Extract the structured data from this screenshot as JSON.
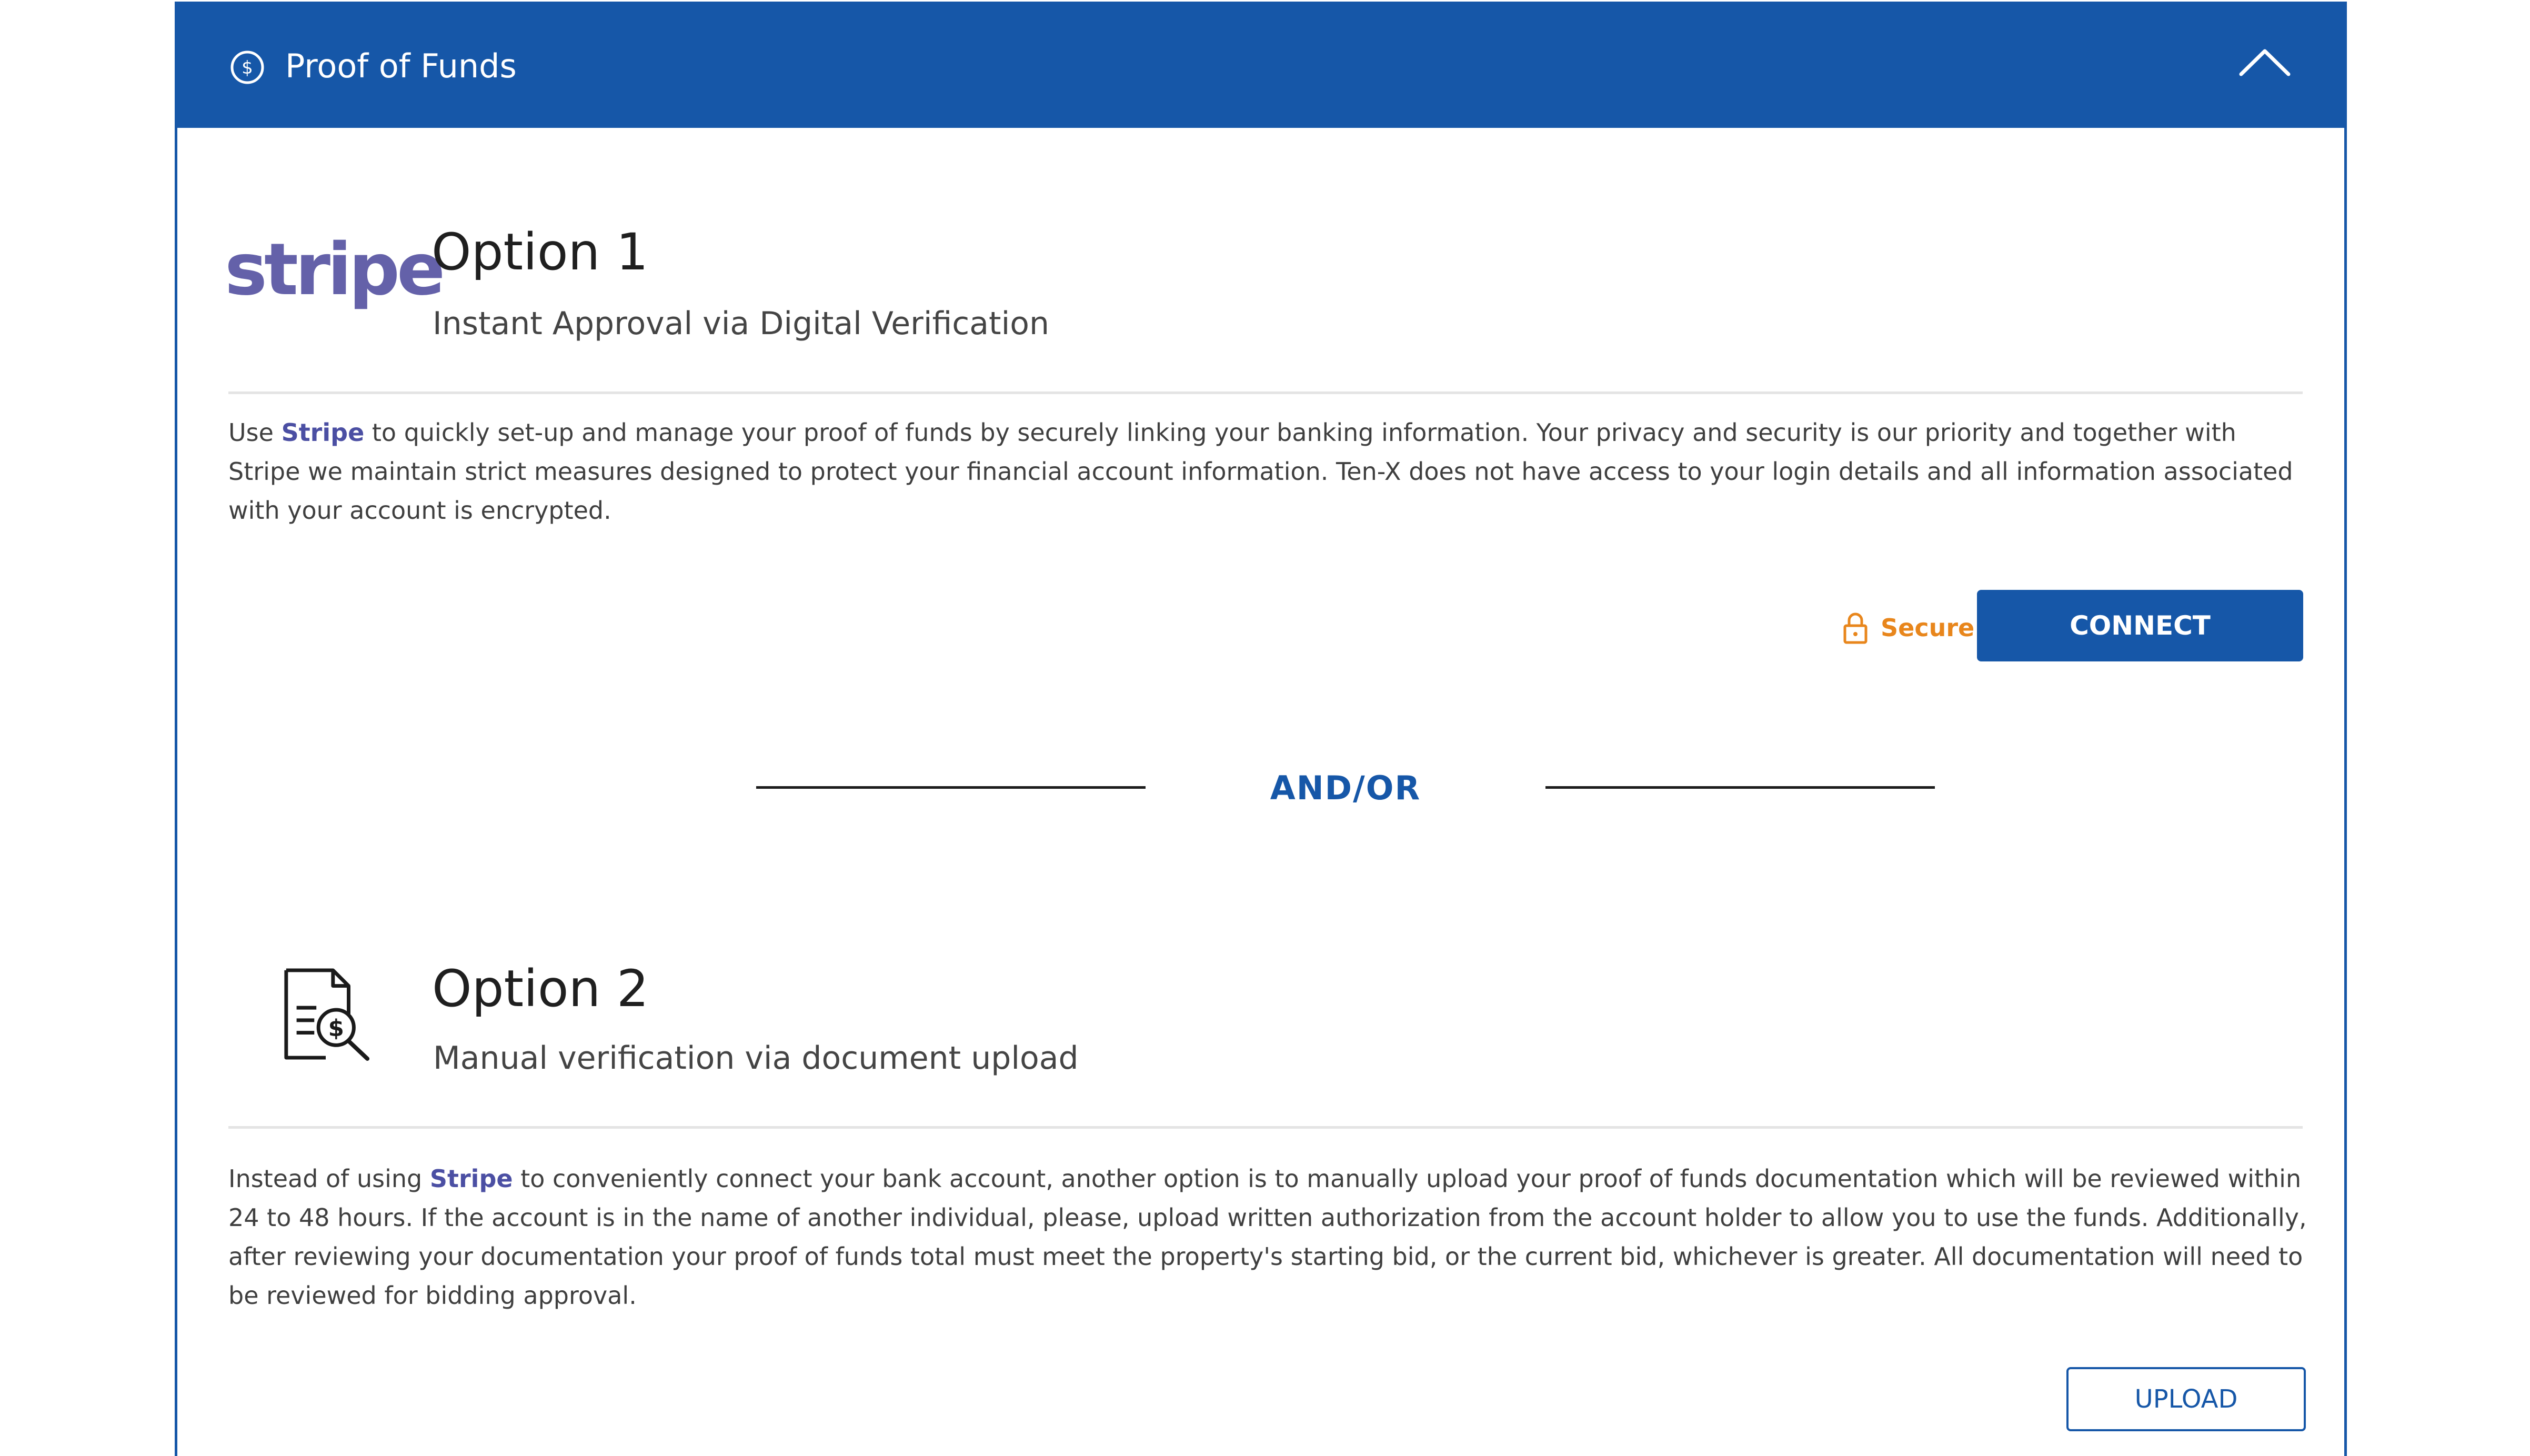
{
  "header": {
    "title": "Proof of Funds",
    "icon": "dollar-circle-icon",
    "collapse_icon": "chevron-up-icon"
  },
  "option1": {
    "logo_text": "stripe",
    "title": "Option 1",
    "subtitle": "Instant Approval via Digital Verification",
    "paragraph": {
      "prefix": "Use ",
      "highlight": "Stripe",
      "suffix": " to quickly set-up and manage your proof of funds by securely linking your banking information. Your privacy and security is our priority and together with Stripe we maintain strict measures designed to protect your financial account information. Ten-X does not have access to your login details and all information associated with your account is encrypted."
    },
    "secure_label": "Secure",
    "connect_label": "CONNECT"
  },
  "separator": {
    "label": "AND/OR"
  },
  "option2": {
    "title": "Option 2",
    "subtitle": "Manual verification via document upload",
    "paragraph": {
      "prefix": "Instead of using ",
      "highlight": "Stripe",
      "suffix": " to conveniently connect your bank account, another option is to manually upload your proof of funds documentation which will be reviewed within 24 to 48 hours. If the account is in the name of another individual, please, upload written authorization from the account holder to allow you to use the funds. Additionally, after reviewing your documentation your proof of funds total must meet the property's starting bid, or the current bid, whichever is greater. All documentation will need to be reviewed for bidding approval."
    },
    "upload_label": "UPLOAD"
  },
  "colors": {
    "brand_blue": "#1657a8",
    "stripe_purple": "#6461a9",
    "secure_orange": "#e8861c"
  }
}
